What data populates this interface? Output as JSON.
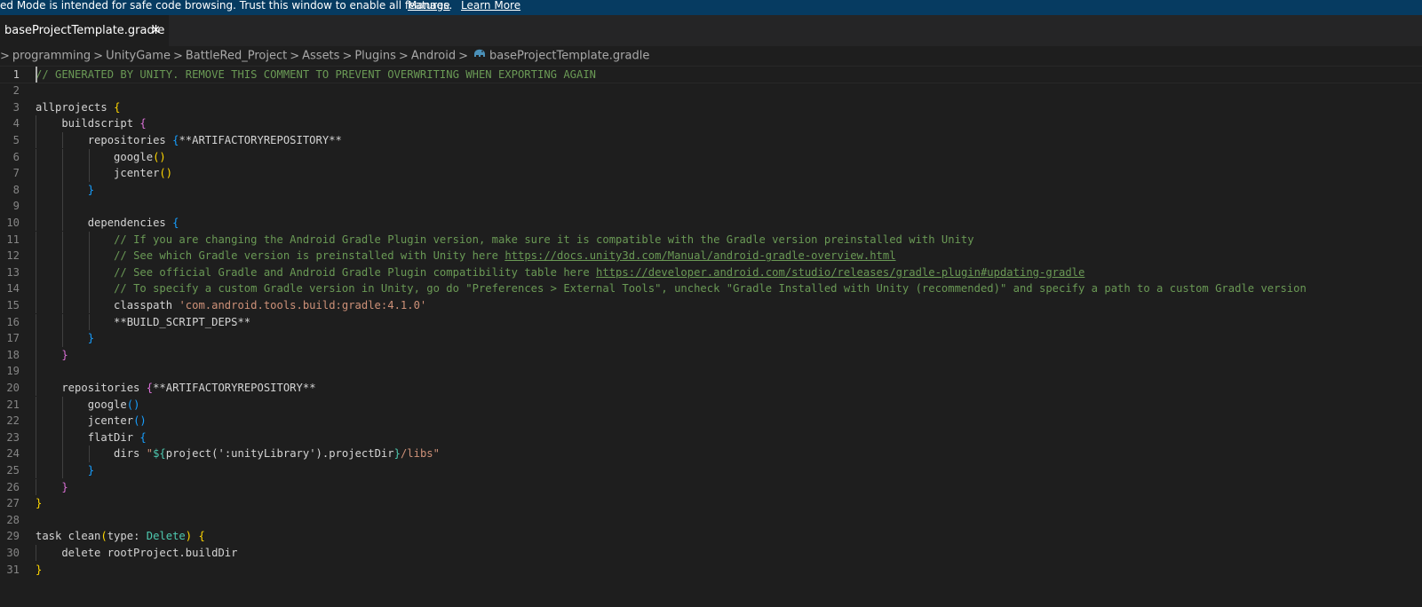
{
  "banner": {
    "message": "ed Mode is intended for safe code browsing. Trust this window to enable all features.",
    "manage_label": "Manage",
    "learn_more_label": "Learn More"
  },
  "tab": {
    "title": "baseProjectTemplate.gradle",
    "close_glyph": "✕"
  },
  "breadcrumb": {
    "items": [
      "programming",
      "UnityGame",
      "BattleRed_Project",
      "Assets",
      "Plugins",
      "Android"
    ],
    "file": "baseProjectTemplate.gradle",
    "separator": ">"
  },
  "editor": {
    "current_line": 1,
    "lines": [
      "// GENERATED BY UNITY. REMOVE THIS COMMENT TO PREVENT OVERWRITING WHEN EXPORTING AGAIN",
      "",
      "allprojects {",
      "    buildscript {",
      "        repositories {**ARTIFACTORYREPOSITORY**",
      "            google()",
      "            jcenter()",
      "        }",
      "",
      "        dependencies {",
      "            // If you are changing the Android Gradle Plugin version, make sure it is compatible with the Gradle version preinstalled with Unity",
      "            // See which Gradle version is preinstalled with Unity here https://docs.unity3d.com/Manual/android-gradle-overview.html",
      "            // See official Gradle and Android Gradle Plugin compatibility table here https://developer.android.com/studio/releases/gradle-plugin#updating-gradle",
      "            // To specify a custom Gradle version in Unity, go do \"Preferences > External Tools\", uncheck \"Gradle Installed with Unity (recommended)\" and specify a path to a custom Gradle version",
      "            classpath 'com.android.tools.build:gradle:4.1.0'",
      "            **BUILD_SCRIPT_DEPS**",
      "        }",
      "    }",
      "",
      "    repositories {**ARTIFACTORYREPOSITORY**",
      "        google()",
      "        jcenter()",
      "        flatDir {",
      "            dirs \"${project(':unityLibrary').projectDir}/libs\"",
      "        }",
      "    }",
      "}",
      "",
      "task clean(type: Delete) {",
      "    delete rootProject.buildDir",
      "}"
    ]
  },
  "colors": {
    "banner_bg": "#063b61",
    "editor_bg": "#1e1e1e",
    "tabbar_bg": "#252526",
    "comment": "#6a9955",
    "string": "#ce9178",
    "type": "#4ec9b0",
    "bracket_1": "#ffd700",
    "bracket_2": "#da70d6",
    "bracket_3": "#179fff",
    "text": "#d4d4d4",
    "line_number": "#858585"
  }
}
